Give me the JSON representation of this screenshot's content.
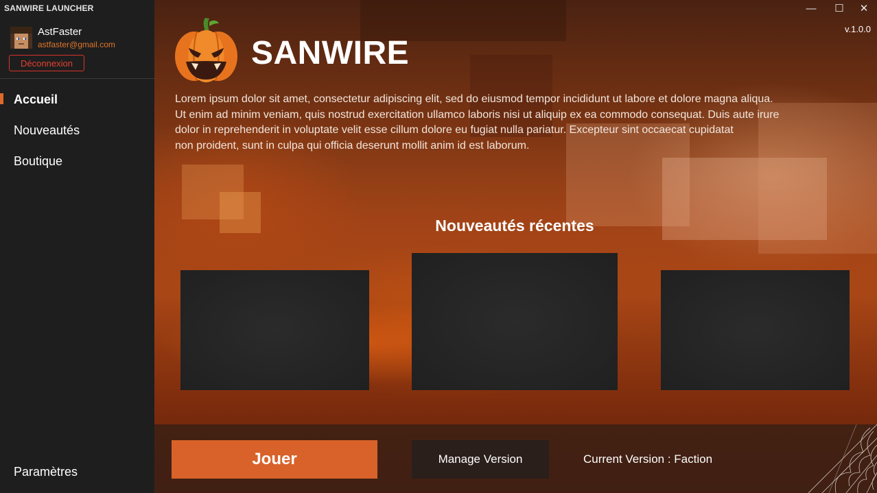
{
  "titlebar": {
    "title": "SANWIRE LAUNCHER",
    "minimize": "—",
    "maximize": "☐",
    "close": "✕"
  },
  "user": {
    "name": "AstFaster",
    "email": "astfaster@gmail.com",
    "logout_label": "Déconnexion"
  },
  "nav": {
    "items": [
      {
        "label": "Accueil",
        "active": true
      },
      {
        "label": "Nouveautés",
        "active": false
      },
      {
        "label": "Boutique",
        "active": false
      }
    ],
    "settings_label": "Paramètres"
  },
  "main": {
    "brand": "SANWIRE",
    "version": "v.1.0.0",
    "description_lines": [
      "Lorem ipsum dolor sit amet, consectetur adipiscing elit, sed do eiusmod tempor incididunt ut labore et dolore magna aliqua.",
      "Ut enim ad minim veniam, quis nostrud exercitation ullamco laboris nisi ut aliquip ex ea commodo consequat. Duis aute irure",
      "dolor in reprehenderit in voluptate velit esse cillum dolore eu fugiat nulla pariatur. Excepteur sint occaecat cupidatat",
      "non proident, sunt in culpa qui officia deserunt mollit anim id est laborum."
    ],
    "news_title": "Nouveautés récentes"
  },
  "footer": {
    "play_label": "Jouer",
    "manage_label": "Manage Version",
    "current_version": "Current Version : Faction"
  },
  "colors": {
    "accent": "#d8622a",
    "danger": "#d8342b",
    "sidebar": "#1e1e1e"
  },
  "icons": {
    "logo": "pumpkin-icon",
    "decoration": "cobweb-icon"
  }
}
